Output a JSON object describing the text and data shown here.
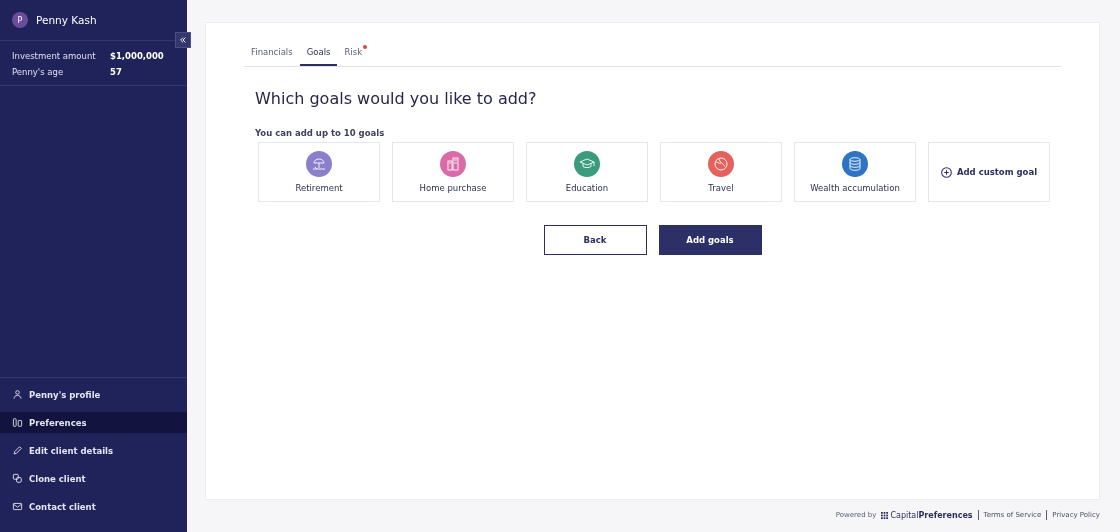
{
  "client": {
    "initial": "P",
    "name": "Penny Kash"
  },
  "facts": [
    {
      "label": "Investment amount",
      "value": "$1,000,000"
    },
    {
      "label": "Penny's age",
      "value": "57"
    }
  ],
  "nav": [
    {
      "label": "Penny's profile",
      "kind": "person",
      "selected": false
    },
    {
      "label": "Preferences",
      "kind": "columns",
      "selected": true
    },
    {
      "label": "Edit client details",
      "kind": "pencil",
      "selected": false
    },
    {
      "label": "Clone client",
      "kind": "clone",
      "selected": false
    },
    {
      "label": "Contact client",
      "kind": "mail",
      "selected": false
    }
  ],
  "tabs": [
    {
      "label": "Financials",
      "selected": false,
      "alert": false
    },
    {
      "label": "Goals",
      "selected": true,
      "alert": false
    },
    {
      "label": "Risk",
      "selected": false,
      "alert": true
    }
  ],
  "heading": "Which goals would you like to add?",
  "hint": "You can add up to 10 goals",
  "goals": [
    {
      "label": "Retirement",
      "kind": "umbrella",
      "color": "#8b7fc9"
    },
    {
      "label": "Home purchase",
      "kind": "house",
      "color": "#d86ba8"
    },
    {
      "label": "Education",
      "kind": "cap",
      "color": "#3a9c7c"
    },
    {
      "label": "Travel",
      "kind": "globe",
      "color": "#e4625d"
    },
    {
      "label": "Wealth accumulation",
      "kind": "coins",
      "color": "#2e73c4"
    }
  ],
  "custom_goal": "Add custom goal",
  "buttons": {
    "back": "Back",
    "add": "Add goals"
  },
  "footer": {
    "powered_by": "Powered by",
    "brand": "Capital**Preferences**",
    "links": [
      "Terms of Service",
      "Privacy Policy"
    ]
  }
}
